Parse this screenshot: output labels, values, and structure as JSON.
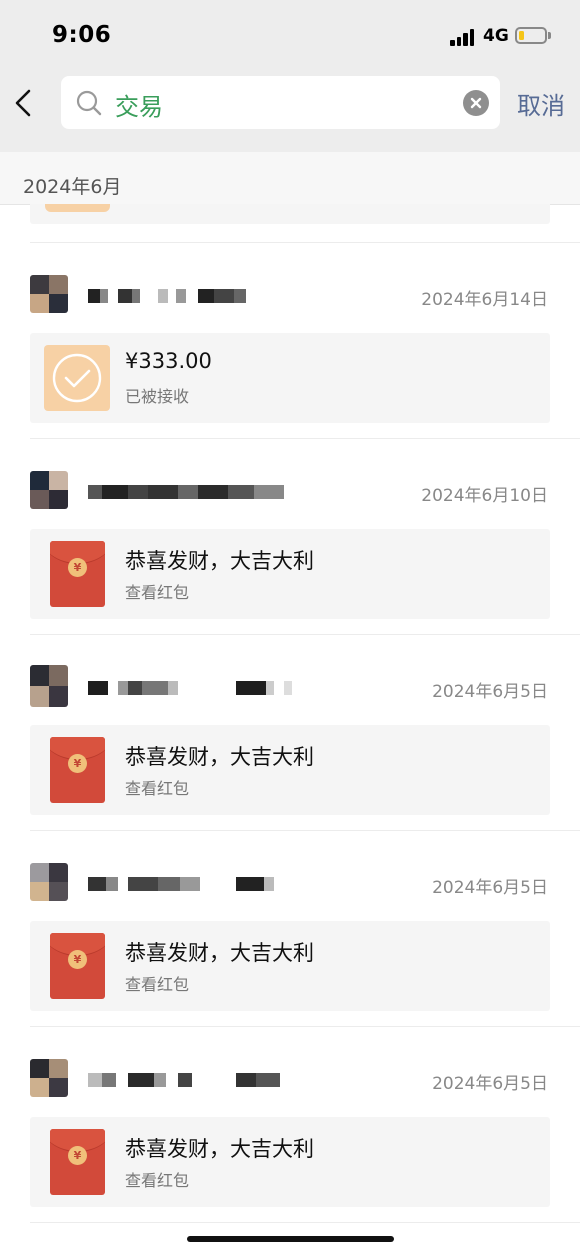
{
  "status_bar": {
    "time": "9:06",
    "network": "4G"
  },
  "search": {
    "back_icon": "chevron-left-icon",
    "query": "交易",
    "cancel_label": "取消"
  },
  "month_header": "2024年6月",
  "items": [
    {
      "type": "transfer",
      "date": "2024年6月14日",
      "title": "¥333.00",
      "subtitle": "已被接收"
    },
    {
      "type": "red_packet",
      "date": "2024年6月10日",
      "title": "恭喜发财，大吉大利",
      "subtitle": "查看红包"
    },
    {
      "type": "red_packet",
      "date": "2024年6月5日",
      "title": "恭喜发财，大吉大利",
      "subtitle": "查看红包"
    },
    {
      "type": "red_packet",
      "date": "2024年6月5日",
      "title": "恭喜发财，大吉大利",
      "subtitle": "查看红包"
    },
    {
      "type": "red_packet",
      "date": "2024年6月5日",
      "title": "恭喜发财，大吉大利",
      "subtitle": "查看红包"
    }
  ],
  "colors": {
    "search_text": "#3a9e5b",
    "cancel": "#576b95",
    "red_packet": "#d24a3a",
    "transfer_icon_bg": "#f7d1a5"
  }
}
